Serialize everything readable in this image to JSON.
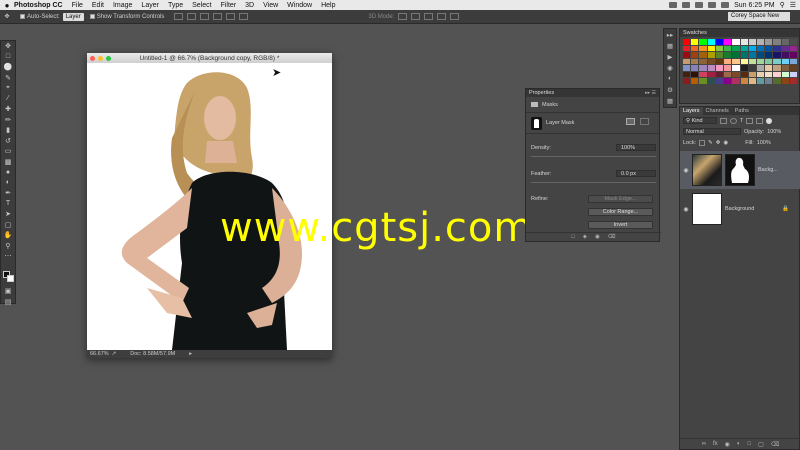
{
  "menubar": {
    "apple": "",
    "app_name": "Photoshop CC",
    "items": [
      "File",
      "Edit",
      "Image",
      "Layer",
      "Type",
      "Select",
      "Filter",
      "3D",
      "View",
      "Window",
      "Help"
    ],
    "clock": "Sun 6:25 PM"
  },
  "options_bar": {
    "auto_select_label": "Auto-Select:",
    "auto_select_value": "Layer",
    "show_transform_label": "Show Transform Controls",
    "mode_3d_label": "3D Mode:",
    "workspace": "Corey Space New"
  },
  "document": {
    "title": "Untitled-1 @ 66.7% (Background copy, RGB/8) *",
    "zoom": "66.67%",
    "doc_size": "Doc: 8.58M/57.9M"
  },
  "watermark": "www.cgtsj.com",
  "properties": {
    "title": "Properties",
    "section": "Masks",
    "mask_type": "Layer Mask",
    "density_label": "Density:",
    "density_value": "100%",
    "feather_label": "Feather:",
    "feather_value": "0.0 px",
    "refine_label": "Refine:",
    "mask_edge_label": "Mask Edge...",
    "color_range_label": "Color Range...",
    "invert_label": "Invert"
  },
  "swatches": {
    "title": "Swatches",
    "colors": [
      "#ff0000",
      "#ffff00",
      "#00ff00",
      "#00ffff",
      "#0000ff",
      "#ff00ff",
      "#ffffff",
      "#e6e6e6",
      "#cccccc",
      "#b3b3b3",
      "#999999",
      "#808080",
      "#666666",
      "#4d4d4d",
      "#ed1c24",
      "#f26522",
      "#f7941d",
      "#fff200",
      "#8dc63f",
      "#39b54a",
      "#00a651",
      "#00a99d",
      "#00aeef",
      "#0072bc",
      "#0054a6",
      "#2e3192",
      "#662d91",
      "#92278f",
      "#9e0b0f",
      "#a0410d",
      "#a36209",
      "#aba000",
      "#598527",
      "#197b30",
      "#007236",
      "#00746b",
      "#0076a3",
      "#004a80",
      "#003471",
      "#1b1464",
      "#440e62",
      "#630460",
      "#c69c6d",
      "#a67c52",
      "#8c6239",
      "#754c24",
      "#603913",
      "#f9ad81",
      "#fdc68a",
      "#fff79a",
      "#c4df9b",
      "#a3d39c",
      "#82ca9d",
      "#7bcdc8",
      "#6ecff6",
      "#7da7d9",
      "#8393ca",
      "#8781bd",
      "#a186be",
      "#bd8cbf",
      "#f49ac1",
      "#f5989d",
      "#ffffff",
      "#231f20",
      "#3c3c3c",
      "#aaaaaa",
      "#e8c8a0",
      "#c0a080",
      "#806040",
      "#604020",
      "#402010",
      "#301000",
      "#d04060",
      "#a02040",
      "#602030",
      "#9a6a4a",
      "#7a4a2a",
      "#5a2a0a",
      "#caa06a",
      "#e8d0b0",
      "#f0e0c8",
      "#ffd0d0",
      "#d0ffd0",
      "#d0d0ff",
      "#8e1b1b",
      "#b85c00",
      "#6b8e23",
      "#2f4f4f",
      "#483d8b",
      "#8b008b",
      "#b03060",
      "#cd853f",
      "#deb887",
      "#5f9ea0",
      "#708090",
      "#556b2f",
      "#8b4513",
      "#a52a2a"
    ]
  },
  "layers": {
    "tabs": [
      "Layers",
      "Channels",
      "Paths"
    ],
    "kind_label": "Kind",
    "blend_mode": "Normal",
    "opacity_label": "Opacity:",
    "opacity_value": "100%",
    "lock_label": "Lock:",
    "fill_label": "Fill:",
    "fill_value": "100%",
    "items": [
      {
        "name": "Backg..."
      },
      {
        "name": "Background"
      }
    ]
  }
}
